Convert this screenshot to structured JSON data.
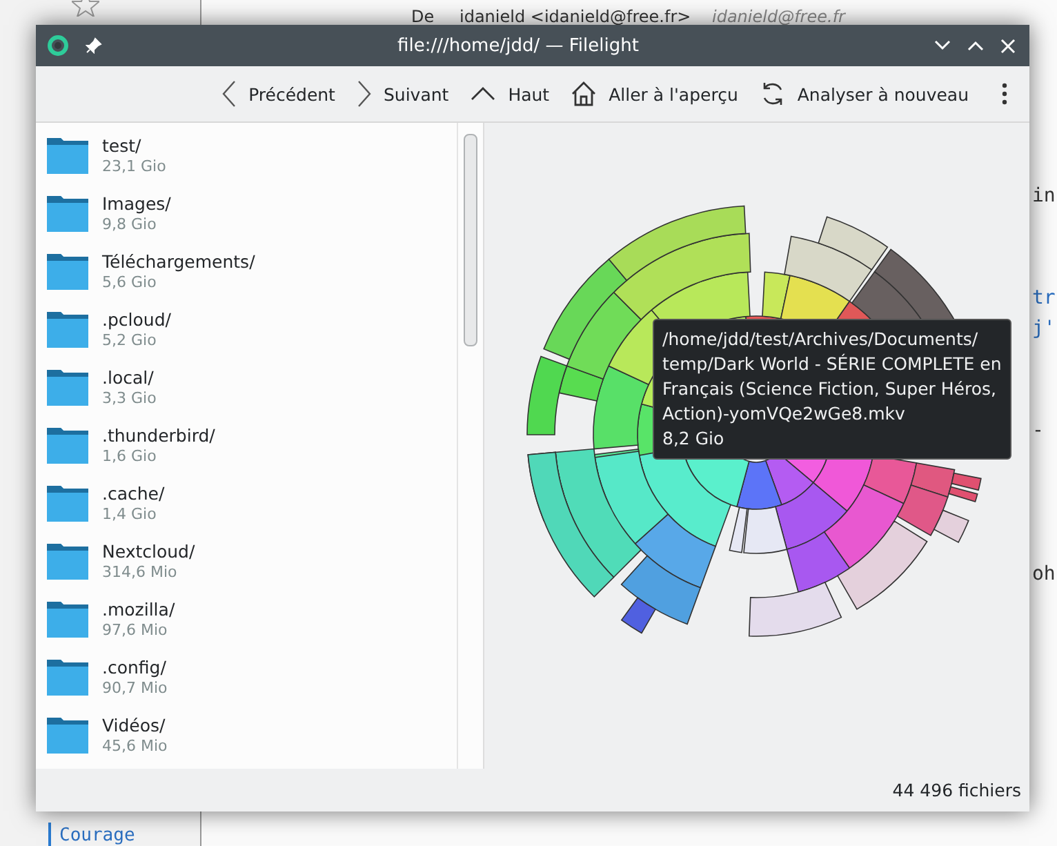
{
  "background": {
    "email_header": {
      "label": "De",
      "sender": "idanield <idanield@free.fr>",
      "address": "idanield@free.fr"
    },
    "code_fragments": [
      {
        "text": "in",
        "kind": "plain"
      },
      {
        "text": "tr",
        "kind": "link"
      },
      {
        "text": "j'",
        "kind": "link"
      },
      {
        "text": "-",
        "kind": "plain"
      },
      {
        "text": "oh",
        "kind": "plain"
      }
    ],
    "sidebar_item": "Courage"
  },
  "window": {
    "title": "file:///home/jdd/ — Filelight"
  },
  "toolbar": [
    "Précédent",
    "Suivant",
    "Haut",
    "Aller à l'aperçu",
    "Analyser à nouveau"
  ],
  "folders": [
    {
      "name": "test/",
      "size": "23,1 Gio"
    },
    {
      "name": "Images/",
      "size": "9,8 Gio"
    },
    {
      "name": "Téléchargements/",
      "size": "5,6 Gio"
    },
    {
      "name": ".pcloud/",
      "size": "5,2 Gio"
    },
    {
      "name": ".local/",
      "size": "3,3 Gio"
    },
    {
      "name": ".thunderbird/",
      "size": "1,6 Gio"
    },
    {
      "name": ".cache/",
      "size": "1,4 Gio"
    },
    {
      "name": "Nextcloud/",
      "size": "314,6 Mio"
    },
    {
      "name": ".mozilla/",
      "size": "97,6 Mio"
    },
    {
      "name": ".config/",
      "size": "90,7 Mio"
    },
    {
      "name": "Vidéos/",
      "size": "45,6 Mio"
    }
  ],
  "tooltip": {
    "path_lines": [
      "/home/jdd/test/Archives/Documents/",
      "temp/Dark World - SÉRIE COMPLETE en",
      "Français (Science Fiction, Super Héros,",
      "Action)-yomVQe2wGe8.mkv"
    ],
    "size": "8,2 Gio"
  },
  "status_bar": "44 496 fichiers"
}
